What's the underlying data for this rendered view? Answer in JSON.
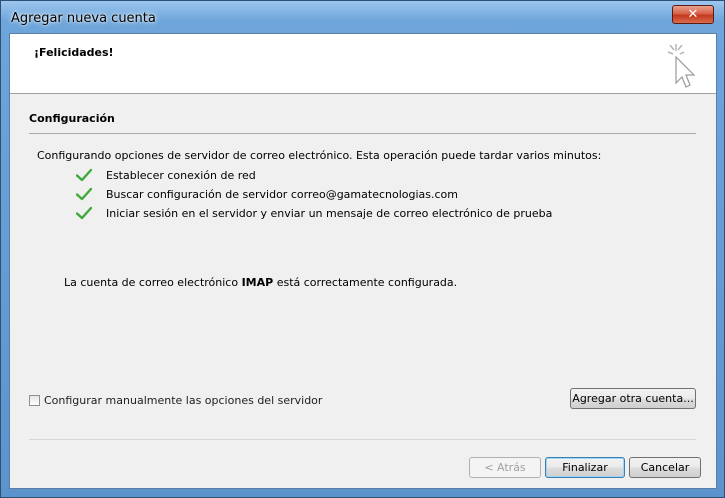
{
  "window": {
    "title": "Agregar nueva cuenta",
    "close_label": "✕"
  },
  "header": {
    "title": "¡Felicidades!",
    "icon": "cursor-sparkle-icon"
  },
  "section": {
    "title": "Configuración",
    "intro": "Configurando opciones de servidor de correo electrónico. Esta operación puede tardar varios minutos:",
    "steps": [
      {
        "label": "Establecer conexión de red",
        "status": "done",
        "icon": "check-icon"
      },
      {
        "label": "Buscar configuración de servidor correo@gamatecnologias.com",
        "status": "done",
        "icon": "check-icon"
      },
      {
        "label": "Iniciar sesión en el servidor y enviar un mensaje de correo electrónico de prueba",
        "status": "done",
        "icon": "check-icon"
      }
    ]
  },
  "result": {
    "before": "La cuenta de correo electrónico ",
    "protocol": "IMAP",
    "after": " está correctamente configurada."
  },
  "options": {
    "manual_config_label": "Configurar manualmente las opciones del servidor",
    "manual_config_checked": false,
    "add_another_label": "Agregar otra cuenta..."
  },
  "footer": {
    "back_label": "< Atrás",
    "finish_label": "Finalizar",
    "cancel_label": "Cancelar"
  },
  "colors": {
    "check": "#3fa93a",
    "titlebar": "#6ea5da",
    "close_button": "#c4381c"
  }
}
